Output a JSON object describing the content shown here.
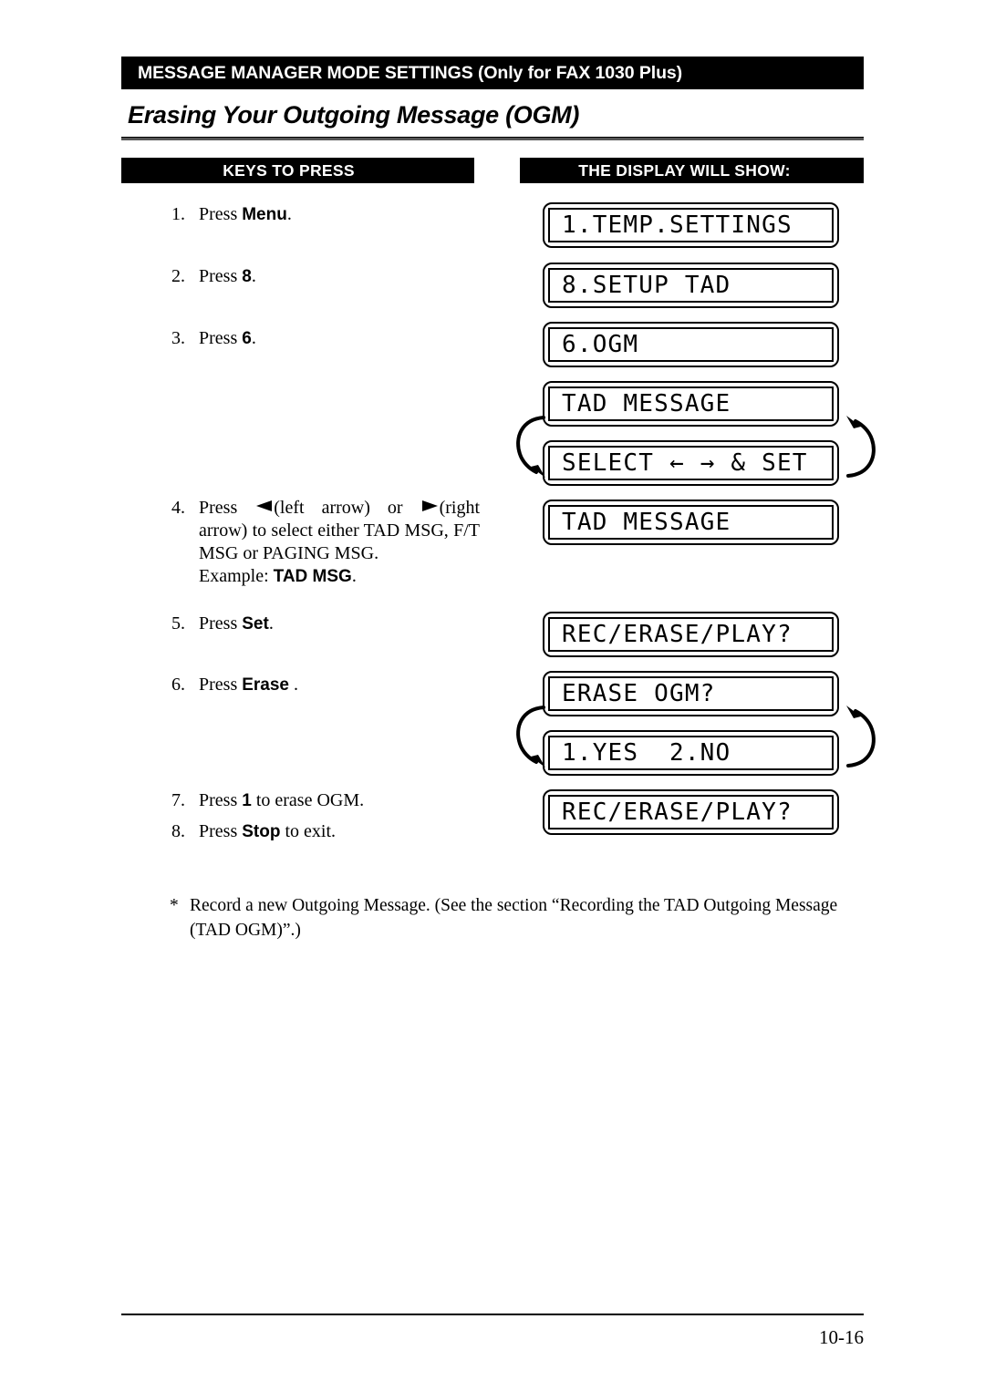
{
  "header": {
    "bar_text": "MESSAGE MANAGER MODE SETTINGS (Only for FAX 1030 Plus)",
    "section_title": "Erasing Your Outgoing Message (OGM)"
  },
  "columns": {
    "keys_header": "KEYS TO PRESS",
    "display_header": "THE DISPLAY WILL SHOW:"
  },
  "steps": [
    {
      "num": "1.",
      "pre": "Press ",
      "key": "Menu",
      "post": "."
    },
    {
      "num": "2.",
      "pre": "Press ",
      "key": "8",
      "post": "."
    },
    {
      "num": "3.",
      "pre": "Press ",
      "key": "6",
      "post": "."
    },
    {
      "num": "4.",
      "pre": "Press ",
      "left_arrow_label": "(left arrow) or ",
      "right_arrow_label": "(right arrow) to select either TAD MSG, F/T MSG or PAGING MSG. ",
      "example_label": "Example: ",
      "example_value": "TAD MSG",
      "post": "."
    },
    {
      "num": "5.",
      "pre": "Press ",
      "key": "Set",
      "post": "."
    },
    {
      "num": "6.",
      "pre": "Press ",
      "key": "Erase",
      "post": " ."
    },
    {
      "num": "7.",
      "pre": "Press ",
      "key": "1",
      "post": " to erase OGM."
    },
    {
      "num": "8.",
      "pre": "Press ",
      "key": "Stop",
      "post": " to exit."
    }
  ],
  "displays": [
    {
      "id": "d1",
      "text": "1.TEMP.SETTINGS"
    },
    {
      "id": "d2",
      "text": "8.SETUP TAD"
    },
    {
      "id": "d3",
      "text": "6.OGM"
    },
    {
      "id": "d4",
      "text": "TAD MESSAGE"
    },
    {
      "id": "d5",
      "text": "SELECT ← → & SET"
    },
    {
      "id": "d6",
      "text": "TAD MESSAGE"
    },
    {
      "id": "d7",
      "text": "REC/ERASE/PLAY?"
    },
    {
      "id": "d8",
      "text": "ERASE OGM?"
    },
    {
      "id": "d9",
      "text": "1.YES  2.NO"
    },
    {
      "id": "d10",
      "text": "REC/ERASE/PLAY?"
    }
  ],
  "footnote": {
    "star": "*",
    "text": "Record a new Outgoing Message. (See the section “Recording the TAD Outgoing Message (TAD OGM)”.)"
  },
  "footer": {
    "page_number": "10-16"
  },
  "colors": {
    "bar_background": "#000000",
    "bar_text": "#ffffff",
    "body_text": "#000000",
    "rule": "#555555"
  }
}
